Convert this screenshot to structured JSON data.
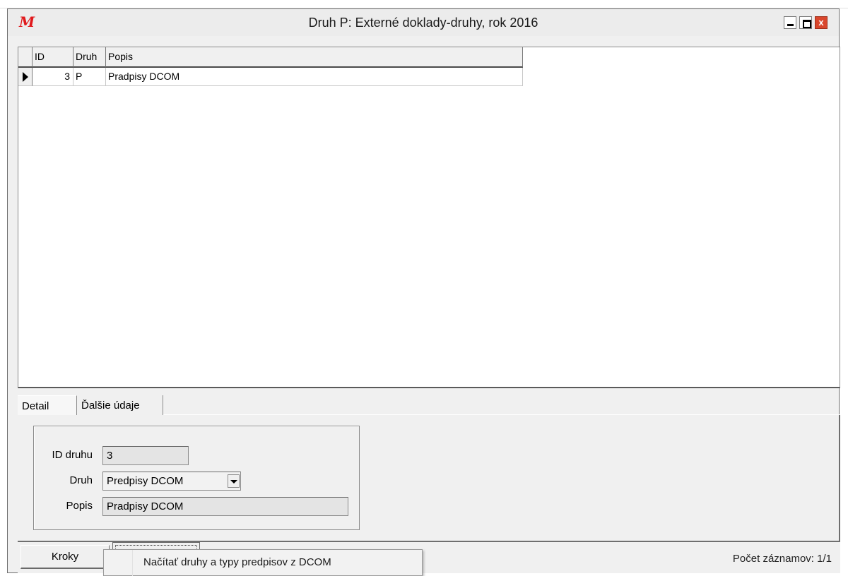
{
  "window": {
    "logo": "M",
    "title": "Druh P:  Externé doklady-druhy, rok 2016",
    "close_label": "x"
  },
  "grid": {
    "columns": [
      "ID",
      "Druh",
      "Popis"
    ],
    "rows": [
      {
        "id": "3",
        "druh": "P",
        "popis": "Pradpisy DCOM"
      }
    ]
  },
  "tabs": [
    {
      "label": "Detail",
      "active": true
    },
    {
      "label": "Ďalšie údaje",
      "active": false
    }
  ],
  "detail": {
    "id_label": "ID druhu",
    "id_value": "3",
    "druh_label": "Druh",
    "druh_value": "Predpisy DCOM",
    "popis_label": "Popis",
    "popis_value": "Pradpisy DCOM"
  },
  "bottom": {
    "kroky_label": "Kroky",
    "status": "Počet záznamov: 1/1"
  },
  "popup": {
    "item": "Načítať druhy a typy predpisov z DCOM"
  },
  "colors": {
    "logo": "#e0191c",
    "close_button": "#d9462c",
    "window_bg": "#f0f0f0"
  },
  "icons": {
    "row_indicator": "triangle-right-icon",
    "dropdown": "chevron-down-icon"
  }
}
